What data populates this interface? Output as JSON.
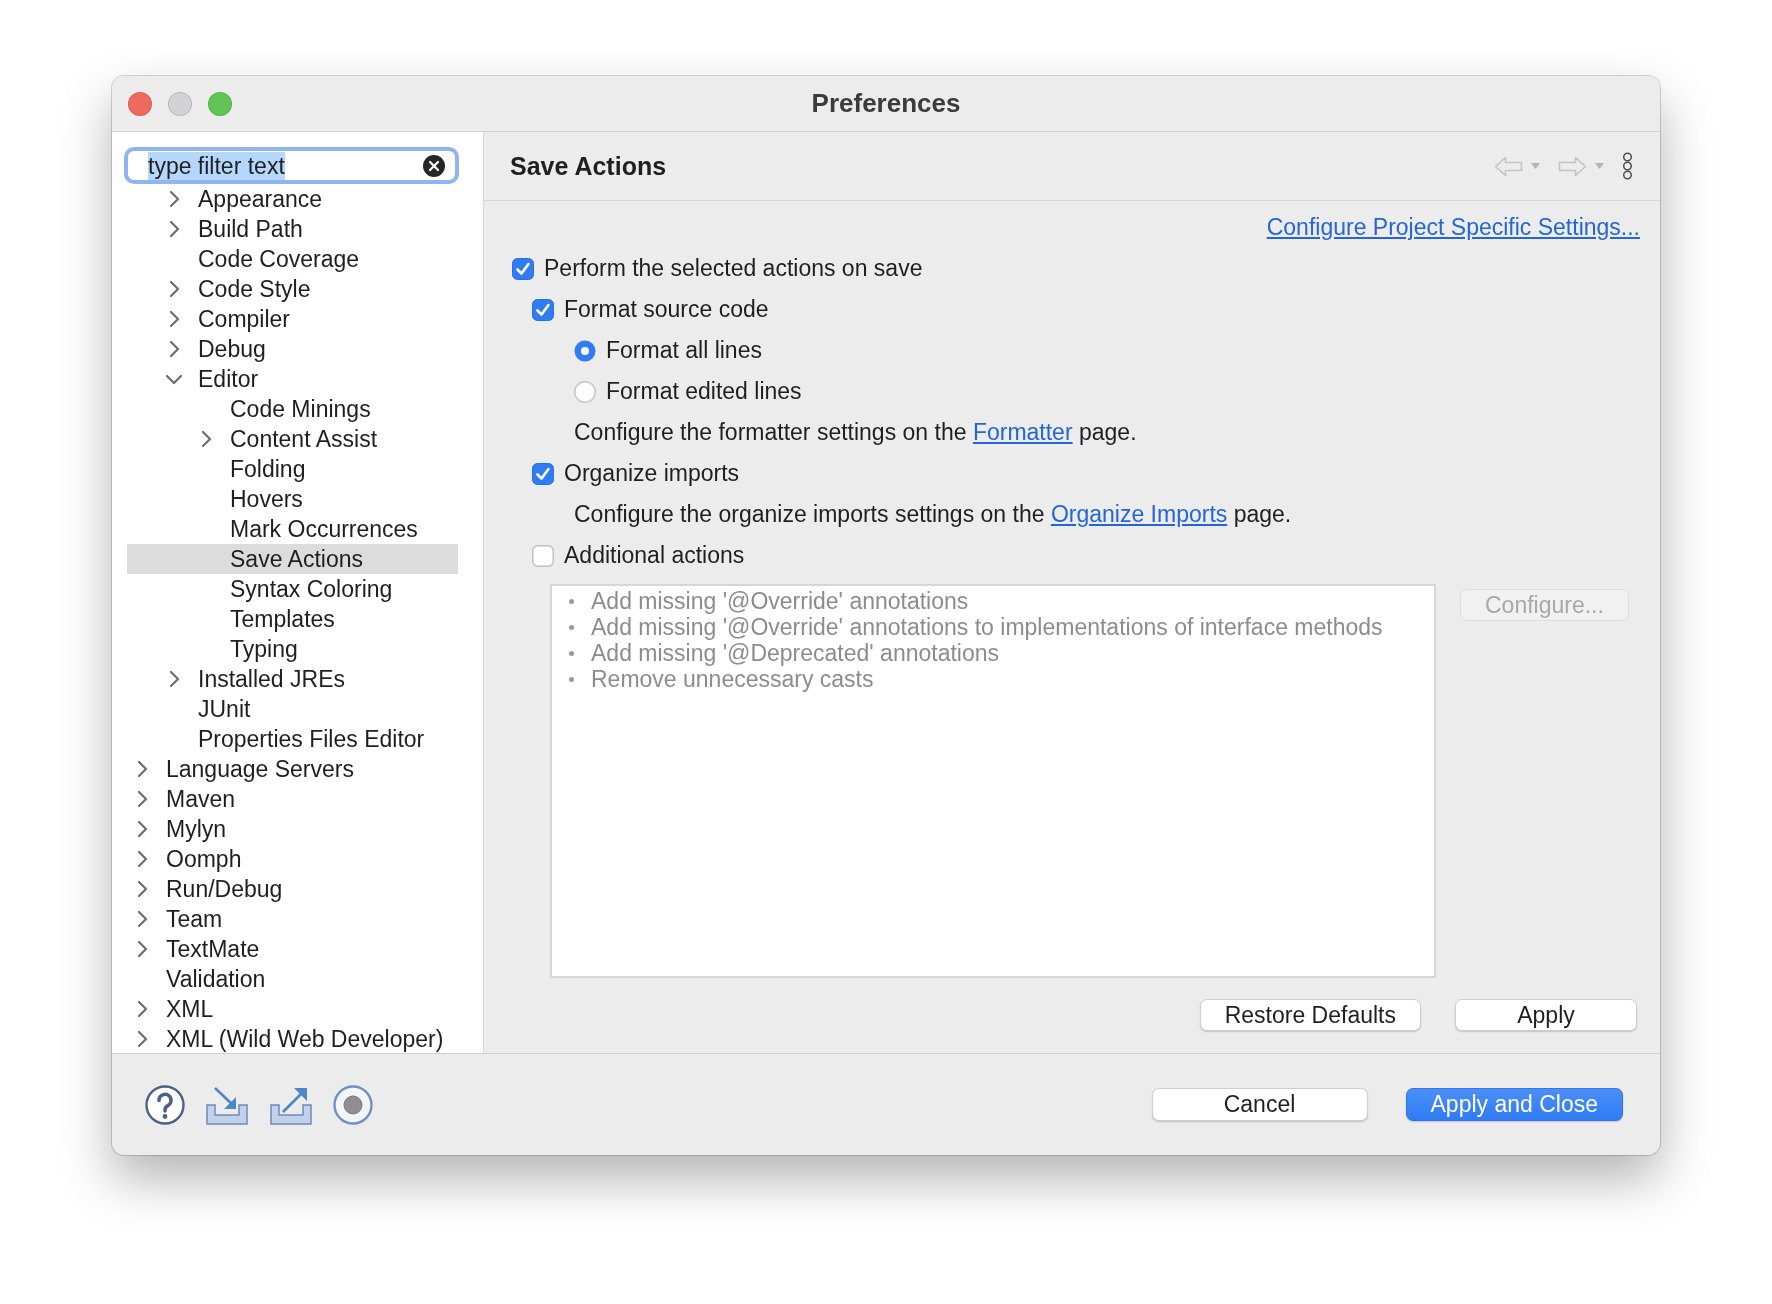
{
  "window": {
    "title": "Preferences"
  },
  "filter": {
    "value": "type filter text",
    "value_selected": true
  },
  "tree": {
    "items": [
      {
        "children": [
          {
            "label": "Appearance",
            "expanded": false,
            "selected": false
          },
          {
            "label": "Build Path",
            "expanded": false,
            "selected": false
          },
          {
            "label": "Code Coverage",
            "selected": false
          },
          {
            "label": "Code Style",
            "expanded": false,
            "selected": false
          },
          {
            "label": "Compiler",
            "expanded": false,
            "selected": false
          },
          {
            "label": "Debug",
            "expanded": false,
            "selected": false
          },
          {
            "label": "Editor",
            "expanded": true,
            "selected": false,
            "children": [
              {
                "label": "Code Minings",
                "selected": false
              },
              {
                "label": "Content Assist",
                "expanded": false,
                "selected": false
              },
              {
                "label": "Folding",
                "selected": false
              },
              {
                "label": "Hovers",
                "selected": false
              },
              {
                "label": "Mark Occurrences",
                "selected": false
              },
              {
                "label": "Save Actions",
                "selected": true
              },
              {
                "label": "Syntax Coloring",
                "selected": false
              },
              {
                "label": "Templates",
                "selected": false
              },
              {
                "label": "Typing",
                "selected": false
              }
            ]
          },
          {
            "label": "Installed JREs",
            "expanded": false,
            "selected": false
          },
          {
            "label": "JUnit",
            "selected": false
          },
          {
            "label": "Properties Files Editor",
            "selected": false
          }
        ]
      },
      {
        "label": "Language Servers",
        "expanded": false,
        "selected": false
      },
      {
        "label": "Maven",
        "expanded": false,
        "selected": false
      },
      {
        "label": "Mylyn",
        "expanded": false,
        "selected": false
      },
      {
        "label": "Oomph",
        "expanded": false,
        "selected": false
      },
      {
        "label": "Run/Debug",
        "expanded": false,
        "selected": false
      },
      {
        "label": "Team",
        "expanded": false,
        "selected": false
      },
      {
        "label": "TextMate",
        "expanded": false,
        "selected": false
      },
      {
        "label": "Validation",
        "selected": false
      },
      {
        "label": "XML",
        "expanded": false,
        "selected": false
      },
      {
        "label": "XML (Wild Web Developer)",
        "expanded": false,
        "selected": false
      }
    ]
  },
  "page": {
    "title": "Save Actions",
    "project_link": "Configure Project Specific Settings...",
    "options": [
      {
        "kind": "checkbox",
        "label": "Perform the selected actions on save",
        "checked": true,
        "children": [
          {
            "kind": "checkbox",
            "label": "Format source code",
            "checked": true,
            "children": [
              {
                "kind": "radio",
                "label": "Format all lines",
                "selected": true
              },
              {
                "kind": "radio",
                "label": "Format edited lines",
                "selected": false
              },
              {
                "kind": "note",
                "before": "Configure the formatter settings on the",
                "link": "Formatter",
                "after": "page."
              }
            ]
          },
          {
            "kind": "checkbox",
            "label": "Organize imports",
            "checked": true,
            "children": [
              {
                "kind": "note",
                "before": "Configure the organize imports settings on the",
                "link": "Organize Imports",
                "after": "page."
              }
            ]
          },
          {
            "kind": "checkbox",
            "label": "Additional actions",
            "checked": false
          }
        ]
      }
    ],
    "action_list": {
      "disabled": true,
      "items": [
        "Add missing '@Override' annotations",
        "Add missing '@Override' annotations to implementations of interface methods",
        "Add missing '@Deprecated' annotations",
        "Remove unnecessary casts"
      ]
    },
    "configure_button": {
      "label": "Configure...",
      "disabled": true
    },
    "buttons": [
      "Restore Defaults",
      "Apply"
    ]
  },
  "dialog_buttons": [
    {
      "label": "Cancel",
      "primary": false
    },
    {
      "label": "Apply and Close",
      "primary": true
    }
  ]
}
